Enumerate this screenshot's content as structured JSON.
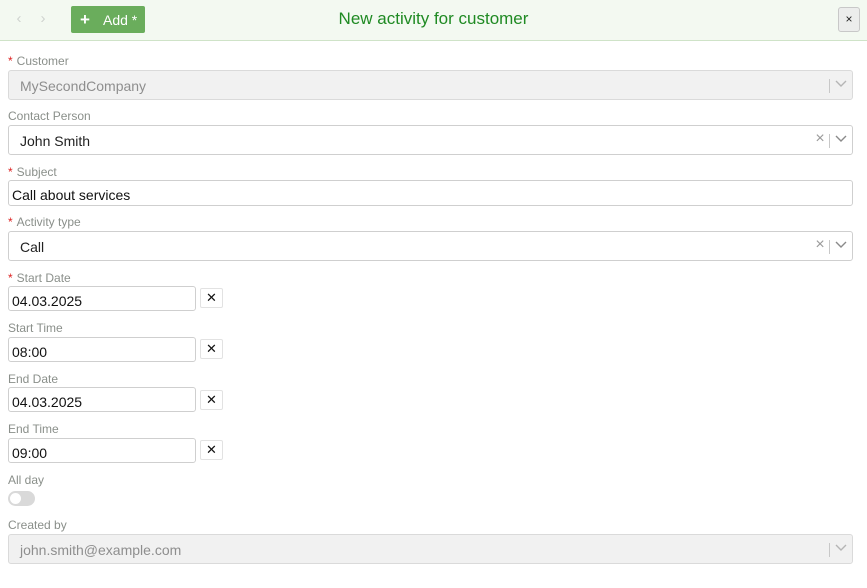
{
  "header": {
    "title": "New activity for customer",
    "add_label": "Add *",
    "close_label": "×",
    "back_glyph": "‹",
    "forward_glyph": "›",
    "plus_glyph": "+"
  },
  "form": {
    "customer": {
      "label": "Customer",
      "required": "*",
      "value": "MySecondCompany"
    },
    "contact_person": {
      "label": "Contact Person",
      "value": "John Smith"
    },
    "subject": {
      "label": "Subject",
      "required": "*",
      "value": "Call about services"
    },
    "activity_type": {
      "label": "Activity type",
      "required": "*",
      "value": "Call"
    },
    "start_date": {
      "label": "Start Date",
      "required": "*",
      "value": "04.03.2025"
    },
    "start_time": {
      "label": "Start Time",
      "value": "08:00"
    },
    "end_date": {
      "label": "End Date",
      "value": "04.03.2025"
    },
    "end_time": {
      "label": "End Time",
      "value": "09:00"
    },
    "all_day": {
      "label": "All day",
      "checked": false
    },
    "created_by": {
      "label": "Created by",
      "value": "john.smith@example.com"
    },
    "clear_glyph": "×",
    "clear_button_glyph": "✕"
  },
  "colors": {
    "header_bg": "#f3f9f1",
    "accent_green": "#1f8a23",
    "add_button": "#6aad5c",
    "required_star": "#dd2222"
  }
}
